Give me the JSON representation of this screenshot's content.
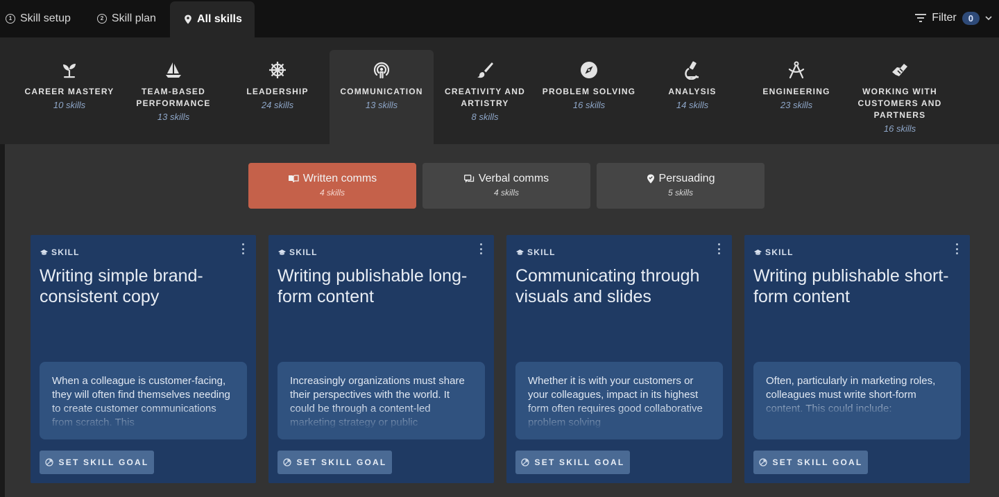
{
  "topnav": {
    "tabs": [
      {
        "label": "Skill setup",
        "icon": "circle-1-icon",
        "num": "1"
      },
      {
        "label": "Skill plan",
        "icon": "circle-2-icon",
        "num": "2"
      },
      {
        "label": "All skills",
        "icon": "map-pin-icon"
      }
    ],
    "filter": {
      "label": "Filter",
      "count": "0"
    }
  },
  "categories": [
    {
      "name": "CAREER MASTERY",
      "count": "10 skills",
      "icon": "sprout-icon"
    },
    {
      "name": "TEAM-BASED PERFORMANCE",
      "count": "13 skills",
      "icon": "sailboat-icon"
    },
    {
      "name": "LEADERSHIP",
      "count": "24 skills",
      "icon": "ship-wheel-icon"
    },
    {
      "name": "COMMUNICATION",
      "count": "13 skills",
      "icon": "broadcast-icon"
    },
    {
      "name": "CREATIVITY AND ARTISTRY",
      "count": "8 skills",
      "icon": "paintbrush-icon"
    },
    {
      "name": "PROBLEM SOLVING",
      "count": "16 skills",
      "icon": "compass-icon"
    },
    {
      "name": "ANALYSIS",
      "count": "14 skills",
      "icon": "microscope-icon"
    },
    {
      "name": "ENGINEERING",
      "count": "23 skills",
      "icon": "drafting-compass-icon"
    },
    {
      "name": "WORKING WITH CUSTOMERS AND PARTNERS",
      "count": "16 skills",
      "icon": "handshake-icon"
    }
  ],
  "subtabs": [
    {
      "label": "Written comms",
      "count": "4 skills",
      "icon": "book-open-icon"
    },
    {
      "label": "Verbal comms",
      "count": "4 skills",
      "icon": "chat-bubbles-icon"
    },
    {
      "label": "Persuading",
      "count": "5 skills",
      "icon": "badge-check-icon"
    }
  ],
  "cards": [
    {
      "label": "SKILL",
      "title": "Writing simple brand-consistent copy",
      "desc": "When a colleague is customer-facing, they will often find themselves needing to create customer communications from scratch. This",
      "button": "SET SKILL GOAL"
    },
    {
      "label": "SKILL",
      "title": "Writing publishable long-form content",
      "desc": "Increasingly organizations must share their perspectives with the world. It could be through a content-led marketing strategy or public",
      "button": "SET SKILL GOAL"
    },
    {
      "label": "SKILL",
      "title": "Communicating through visuals and slides",
      "desc": "Whether it is with your customers or your colleagues, impact in its highest form often requires good collaborative problem solving",
      "button": "SET SKILL GOAL"
    },
    {
      "label": "SKILL",
      "title": "Writing publishable short-form content",
      "desc": "Often, particularly in marketing roles, colleagues must write short-form content. This could include:",
      "button": "SET SKILL GOAL"
    }
  ],
  "colors": {
    "accent": "#c5614a",
    "card": "#1f3a63",
    "card_desc": "#30527f",
    "badge": "#2e4a78"
  }
}
